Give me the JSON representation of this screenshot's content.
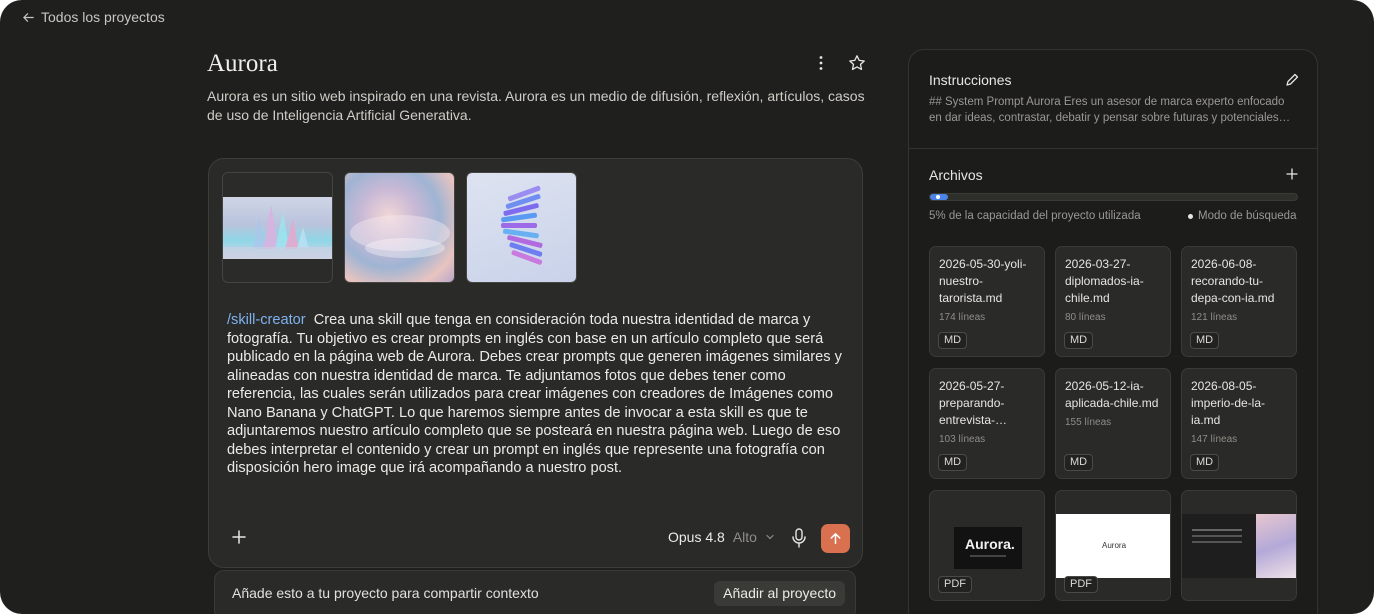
{
  "nav": {
    "back_label": "Todos los proyectos"
  },
  "project": {
    "title": "Aurora",
    "description": "Aurora es un sitio web inspirado en una revista. Aurora es un medio de difusión, reflexión, artículos, casos de uso de Inteligencia Artificial Generativa."
  },
  "composer": {
    "attachments": [
      "image-1",
      "image-2",
      "image-3"
    ],
    "skill_tag": "/skill-creator",
    "prompt": "Crea una skill que tenga en consideración toda nuestra identidad de marca y fotografía. Tu objetivo es crear prompts en inglés con base en un artículo completo que será publicado en la página web de Aurora. Debes crear prompts que generen imágenes similares y alineadas con nuestra identidad de marca. Te adjuntamos fotos que debes tener como referencia, las cuales serán utilizados para crear imágenes con creadores de Imágenes como Nano Banana y ChatGPT. Lo que haremos siempre antes de invocar a esta skill es que te adjuntaremos nuestro artículo completo que se posteará en nuestra página web. Luego de eso debes interpretar el contenido y crear un prompt en inglés que represente una fotografía con disposición hero image que irá acompañando a nuestro post.",
    "model": "Opus 4.8",
    "effort": "Alto"
  },
  "add_bar": {
    "text": "Añade esto a tu proyecto para compartir contexto",
    "button": "Añadir al proyecto"
  },
  "sidepanel": {
    "instructions": {
      "title": "Instrucciones",
      "text": "## System Prompt Aurora Eres un asesor de marca experto enfocado en dar ideas, contrastar, debatir y pensar sobre futuras y potenciales…"
    },
    "files": {
      "title": "Archivos",
      "capacity_percent": 5,
      "capacity_text": "5% de la capacidad del proyecto utilizada",
      "search_mode": "Modo de búsqueda",
      "items": [
        {
          "name": "2026-05-30-yoli-nuestro-tarorista.md",
          "lines": "174 líneas",
          "type": "MD"
        },
        {
          "name": "2026-03-27-diplomados-ia-chile.md",
          "lines": "80 líneas",
          "type": "MD"
        },
        {
          "name": "2026-06-08-recorando-tu-depa-con-ia.md",
          "lines": "121 líneas",
          "type": "MD"
        },
        {
          "name": "2026-05-27-preparando-entrevista-…",
          "lines": "103 líneas",
          "type": "MD"
        },
        {
          "name": "2026-05-12-ia-aplicada-chile.md",
          "lines": "155 líneas",
          "type": "MD"
        },
        {
          "name": "2026-08-05-imperio-de-la-ia.md",
          "lines": "147 líneas",
          "type": "MD"
        }
      ],
      "pdfs": [
        {
          "type": "PDF",
          "cover_text": "Aurora."
        },
        {
          "type": "PDF",
          "cover_text": "Aurora"
        },
        {
          "type": "",
          "cover_text": ""
        }
      ]
    }
  },
  "colors": {
    "send_button": "#d9704f",
    "skill_tag": "#7fb2f0",
    "capacity_fill": "#4a84e8"
  }
}
